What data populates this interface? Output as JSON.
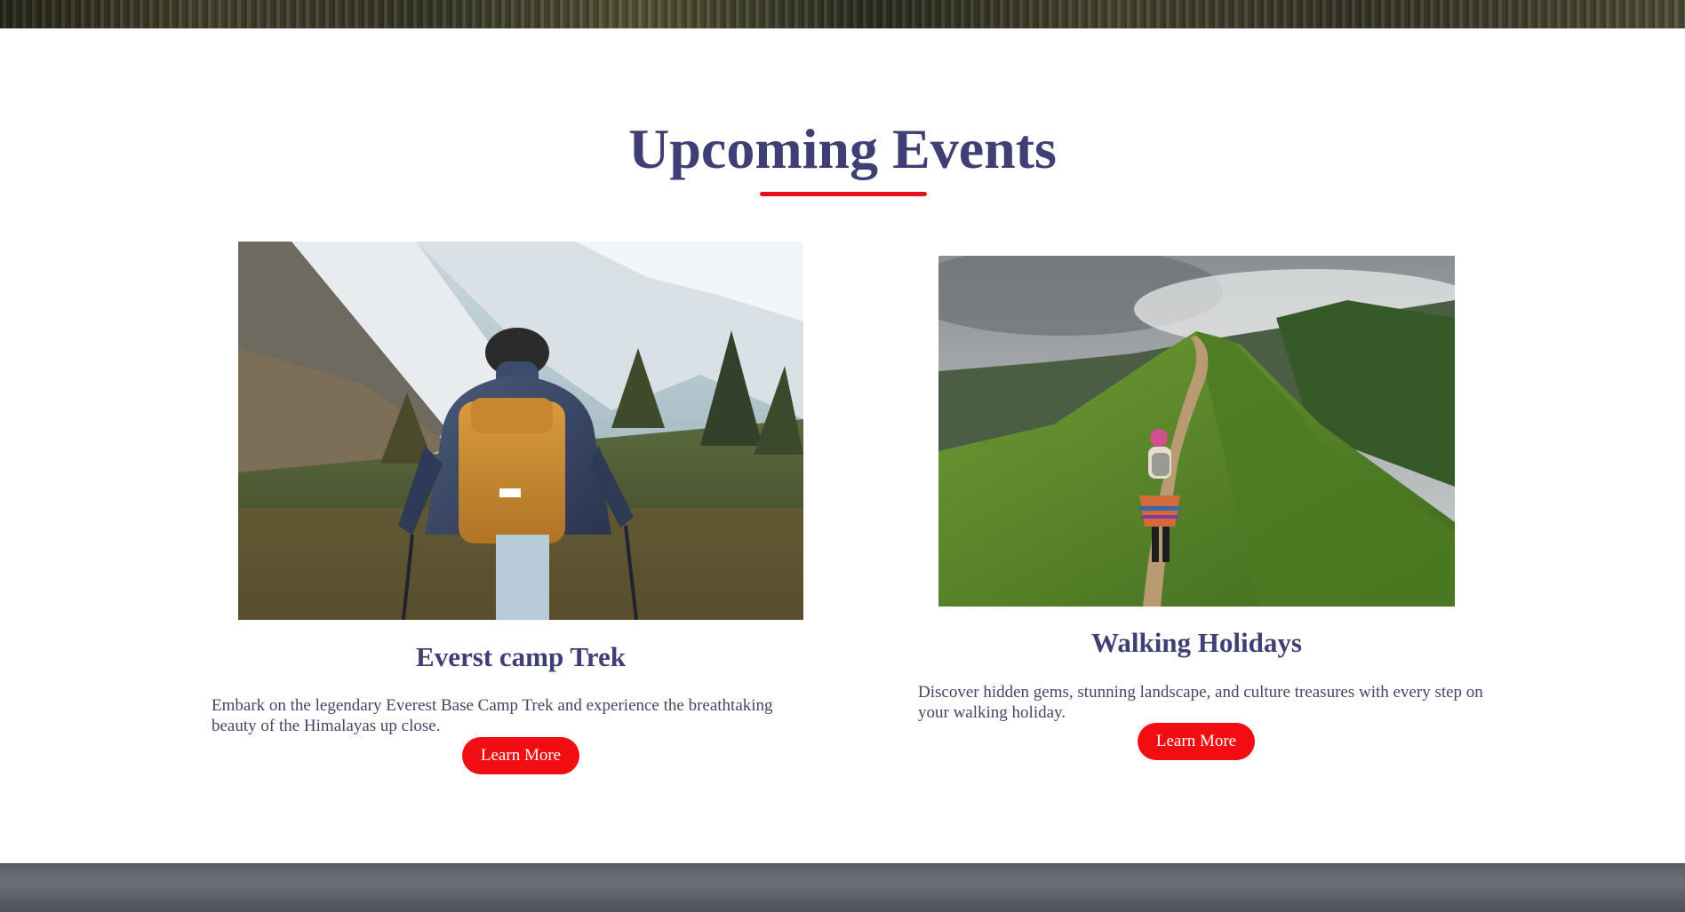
{
  "section": {
    "title": "Upcoming Events"
  },
  "events": [
    {
      "title": "Everst camp Trek",
      "description": "Embark on the legendary Everest Base Camp Trek and experience the breathtaking beauty of the Himalayas up close.",
      "button_label": "Learn More",
      "image": "hiker-with-backpack-mountains-photo"
    },
    {
      "title": "Walking Holidays",
      "description": "Discover hidden gems, stunning landscape, and culture treasures with every step on your walking holiday.",
      "button_label": "Learn More",
      "image": "walker-on-green-ridge-photo"
    }
  ],
  "colors": {
    "heading": "#3f3f75",
    "accent": "#e8101a",
    "button": "#f20d12",
    "body_text": "#454566"
  }
}
